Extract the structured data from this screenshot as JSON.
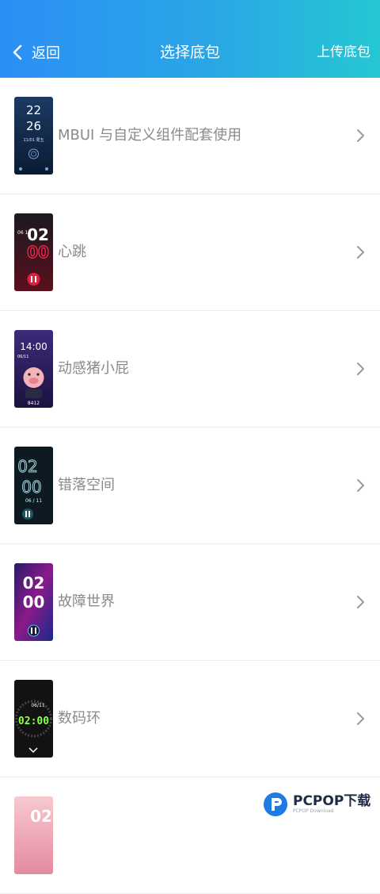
{
  "header": {
    "back_label": "返回",
    "title": "选择底包",
    "upload_label": "上传底包"
  },
  "items": [
    {
      "label": "MBUI 与自定义组件配套使用",
      "thumb_time_top": "22",
      "thumb_time_bottom": "26",
      "thumb_date": "11/01 周五"
    },
    {
      "label": "心跳",
      "thumb_time": "02",
      "thumb_time2": "00",
      "thumb_date": "06 11"
    },
    {
      "label": "动感猪小屁",
      "thumb_time": "14:00",
      "thumb_date": "06/11",
      "thumb_steps": "8412"
    },
    {
      "label": "错落空间",
      "thumb_time": "02",
      "thumb_time2": "00",
      "thumb_date": "06 / 11"
    },
    {
      "label": "故障世界",
      "thumb_time": "02",
      "thumb_time2": "00"
    },
    {
      "label": "数码环",
      "thumb_time": "02:00",
      "thumb_date": "06/11"
    },
    {
      "label": "",
      "thumb_time": "02"
    }
  ],
  "watermark": {
    "main": "PCPOP下载",
    "sub": "PCPOP Download"
  },
  "colors": {
    "header_start": "#2b8ff5",
    "header_end": "#25c7d3",
    "label": "#8a8a8a",
    "chevron": "#9a9a9a"
  }
}
